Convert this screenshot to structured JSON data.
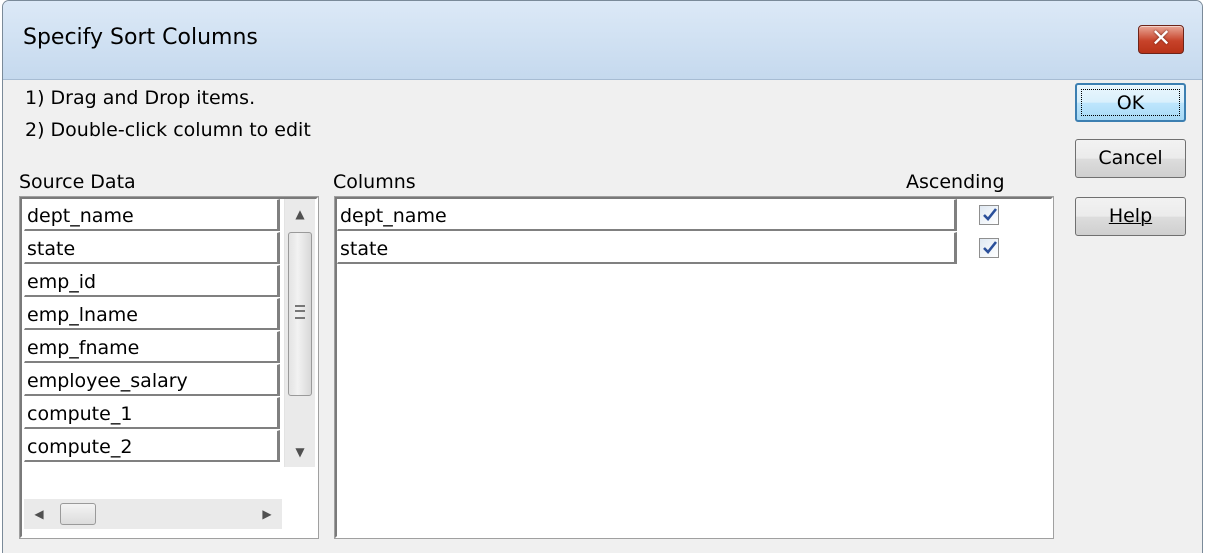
{
  "window": {
    "title": "Specify Sort Columns",
    "close_label": "✕"
  },
  "instructions": [
    "1) Drag and Drop items.",
    "2) Double-click column to edit"
  ],
  "source": {
    "label": "Source Data",
    "items": [
      "dept_name",
      "state",
      "emp_id",
      "emp_lname",
      "emp_fname",
      "employee_salary",
      "compute_1",
      "compute_2"
    ]
  },
  "columns": {
    "label": "Columns",
    "ascending_label": "Ascending",
    "rows": [
      {
        "name": "dept_name",
        "ascending": true
      },
      {
        "name": "state",
        "ascending": true
      }
    ]
  },
  "buttons": {
    "ok": "OK",
    "cancel": "Cancel",
    "help": "Help"
  }
}
